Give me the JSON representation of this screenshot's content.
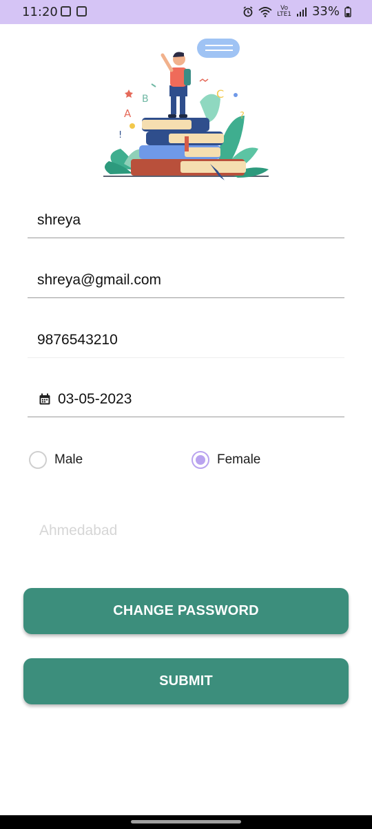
{
  "status_bar": {
    "time": "11:20",
    "network_label": "Vo",
    "network_sublabel": "LTE1",
    "battery": "33%",
    "background": "#d5c4f5"
  },
  "hero": {
    "icon": "student-on-books-illustration"
  },
  "form": {
    "name": "shreya",
    "email": "shreya@gmail.com",
    "phone": "9876543210",
    "date_icon": "calendar-icon",
    "date": "03-05-2023",
    "gender": {
      "options": [
        "Male",
        "Female"
      ],
      "selected": "Female"
    },
    "city_placeholder": "Ahmedabad",
    "accent_color": "#b9a3ef"
  },
  "buttons": {
    "change_password": "CHANGE PASSWORD",
    "submit": "SUBMIT",
    "color": "#3c8e7c"
  }
}
